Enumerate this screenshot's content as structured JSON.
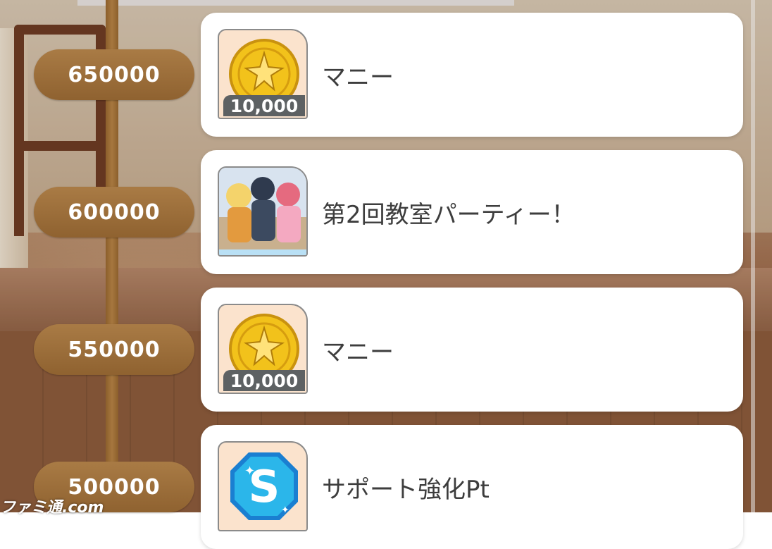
{
  "tiers": [
    {
      "points": "650000",
      "reward_name": "マニー",
      "quantity": "10,000",
      "icon": "coin-icon"
    },
    {
      "points": "600000",
      "reward_name": "第2回教室パーティー！",
      "quantity": "",
      "icon": "card-art-icon"
    },
    {
      "points": "550000",
      "reward_name": "マニー",
      "quantity": "10,000",
      "icon": "coin-icon"
    },
    {
      "points": "500000",
      "reward_name": "サポート強化Pt",
      "quantity": "",
      "icon": "support-pt-icon"
    }
  ],
  "watermark": "ファミ通.com",
  "colors": {
    "pill": "#9b6d38",
    "card": "#ffffff",
    "badge": "#5d6163",
    "text": "#3d3d3d",
    "coin": "#f2c21b",
    "support_icon": "#1fa8e0"
  }
}
